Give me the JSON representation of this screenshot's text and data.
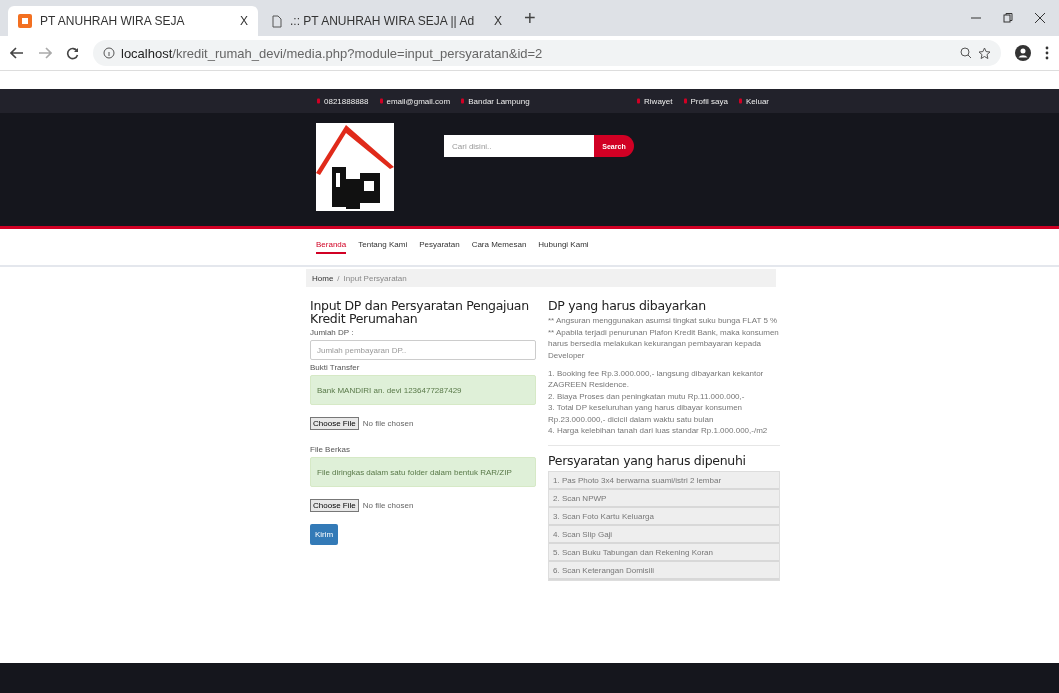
{
  "browser": {
    "tabs": [
      {
        "title": "PT ANUHRAH WIRA SEJA",
        "close": "X",
        "selected": true
      },
      {
        "title": ".:: PT ANUHRAH WIRA SEJA || Ad",
        "close": "X",
        "selected": false
      }
    ],
    "new_tab": "+",
    "url_host": "localhost",
    "url_path": "/kredit_rumah_devi/media.php?module=input_persyaratan&id=2"
  },
  "topbar": {
    "contacts": [
      "0821888888",
      "email@gmail.com",
      "Bandar Lampung"
    ],
    "links": [
      "Riwayet",
      "Profil saya",
      "Keluar"
    ]
  },
  "search": {
    "placeholder": "Cari disini..",
    "button": "Search"
  },
  "nav": [
    {
      "label": "Beranda",
      "selected": true
    },
    {
      "label": "Tentang Kami",
      "selected": false
    },
    {
      "label": "Pesyaratan",
      "selected": false
    },
    {
      "label": "Cara Memesan",
      "selected": false
    },
    {
      "label": "Hubungi Kami",
      "selected": false
    }
  ],
  "breadcrumb": [
    "Home",
    "/",
    "Input Persyaratan"
  ],
  "form": {
    "title": "Input DP dan Persyaratan Pengajuan Kredit Perumahan",
    "dp_label": "Jumlah DP :",
    "dp_placeholder": "Jumlah pembayaran DP..",
    "transfer_label": "Bukti Transfer",
    "transfer_note": "Bank MANDIRI an. devi 1236477287429",
    "file_button": "Choose File",
    "no_file": "No file chosen",
    "berkas_label": "File Berkas",
    "berkas_note": "File diringkas dalam satu folder dalam bentuk RAR/ZIP",
    "berkas_file_button": "Choose File",
    "berkas_no_file": "No file chosen",
    "submit": "Kirim"
  },
  "dp_info": {
    "title": "DP yang harus dibayarkan",
    "notes": [
      "** Angsuran menggunakan asumsi tingkat suku bunga FLAT 5 %",
      "** Apabila terjadi penurunan Plafon Kredit Bank, maka konsumen harus bersedia melakukan kekurangan pembayaran kepada Developer"
    ],
    "items": [
      "1. Booking fee Rp.3.000.000,- langsung dibayarkan kekantor ZAGREEN Residence.",
      "2. Biaya Proses dan peningkatan mutu Rp.11.000.000,-",
      "3. Total DP keseluruhan yang harus dibayar konsumen Rp.23.000.000,- dicicil dalam waktu satu bulan",
      "4. Harga kelebihan tanah dari luas standar Rp.1.000.000,-/m2"
    ]
  },
  "requirements": {
    "title": "Persyaratan yang harus dipenuhi",
    "items": [
      "1. Pas Photo 3x4 berwarna suami/istri 2 lembar",
      "2. Scan NPWP",
      "3. Scan Foto Kartu Keluarga",
      "4. Scan Slip Gaji",
      "5. Scan Buku Tabungan dan Rekening Koran",
      "6. Scan Keterangan Domisili"
    ]
  }
}
